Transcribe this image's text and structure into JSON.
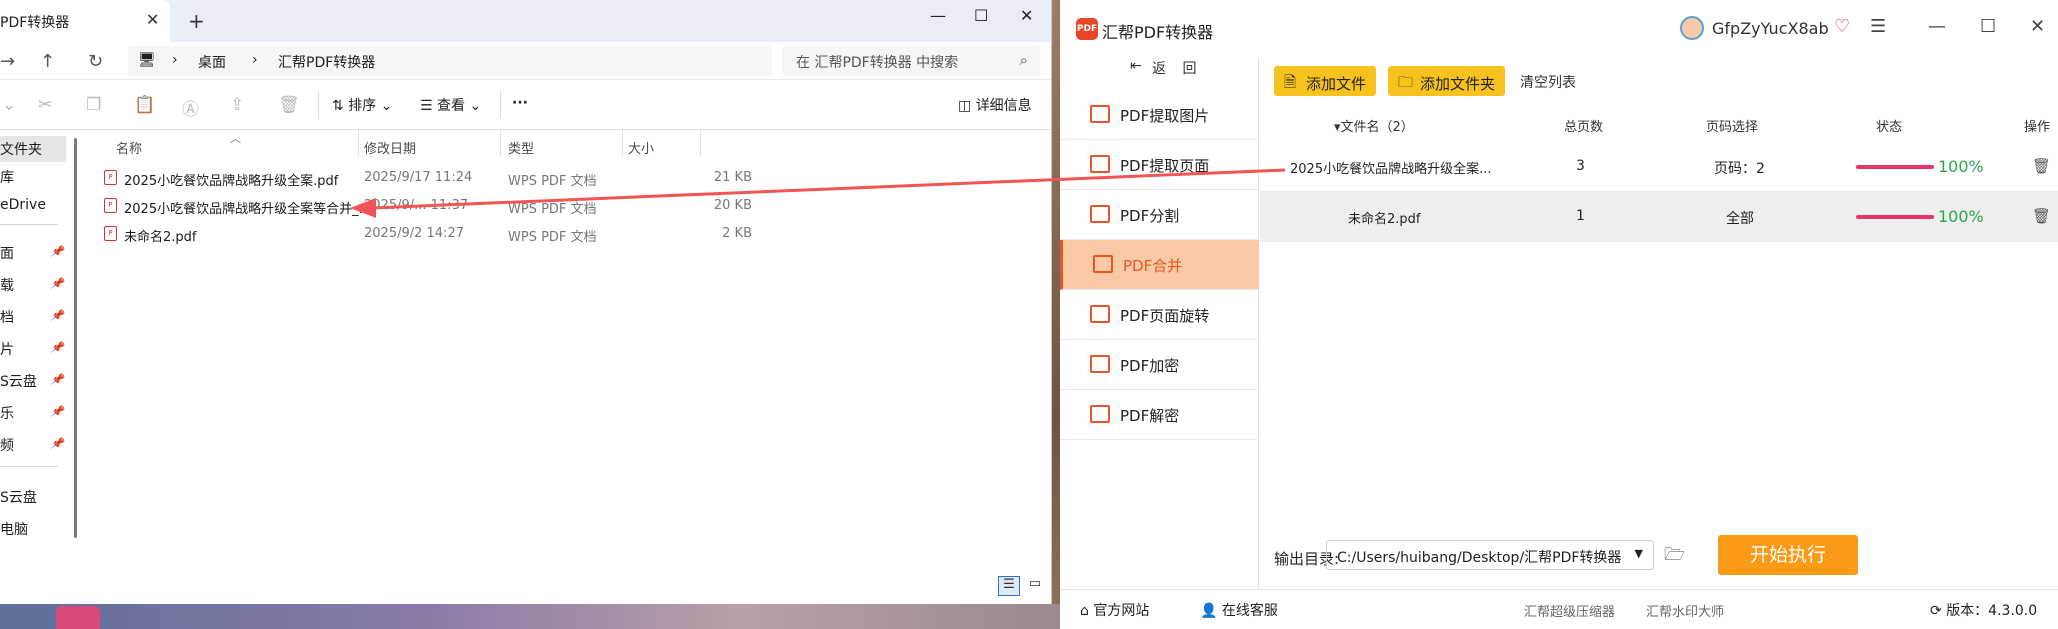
{
  "explorer": {
    "tab_title": "PDF转换器",
    "tab_close": "✕",
    "new_tab": "+",
    "win_controls": [
      "—",
      "☐",
      "✕"
    ],
    "nav": {
      "back": "→",
      "up": "↑",
      "refresh": "↻",
      "pc_icon": "🖥",
      "sep": "›"
    },
    "breadcrumb": [
      "桌面",
      "汇帮PDF转换器"
    ],
    "search_placeholder": "在 汇帮PDF转换器 中搜索",
    "search_icon": "search-icon",
    "toolbar": {
      "sort": "排序",
      "view": "查看",
      "more": "···",
      "details": "详细信息"
    },
    "sidebar": [
      {
        "label": "文件夹",
        "selected": true,
        "pinned": false
      },
      {
        "label": "库",
        "pinned": false
      },
      {
        "label": "eDrive",
        "pinned": false
      },
      {
        "label": "面",
        "pinned": true
      },
      {
        "label": "载",
        "pinned": true
      },
      {
        "label": "档",
        "pinned": true
      },
      {
        "label": "片",
        "pinned": true
      },
      {
        "label": "S云盘",
        "pinned": true
      },
      {
        "label": "乐",
        "pinned": true
      },
      {
        "label": "频",
        "pinned": true
      },
      {
        "label": "S云盘",
        "pinned": false
      },
      {
        "label": "电脑",
        "pinned": false
      }
    ],
    "columns": {
      "name": "名称",
      "modified": "修改日期",
      "type": "类型",
      "size": "大小"
    },
    "files": [
      {
        "name": "2025小吃餐饮品牌战略升级全案.pdf",
        "modified": "2025/9/17 11:24",
        "type": "WPS PDF 文档",
        "size": "21 KB"
      },
      {
        "name": "2025小吃餐饮品牌战略升级全案等合并_...",
        "modified": "2025/9/... 11:37",
        "type": "WPS PDF 文档",
        "size": "20 KB"
      },
      {
        "name": "未命名2.pdf",
        "modified": "2025/9/2 14:27",
        "type": "WPS PDF 文档",
        "size": "2 KB"
      }
    ]
  },
  "app": {
    "logo_text": "PDF",
    "name": "汇帮PDF转换器",
    "user": "GfpZyYucX8ab",
    "win_controls": [
      "☰",
      "—",
      "☐",
      "✕"
    ],
    "back_label": "返 回",
    "menu": [
      {
        "label": "PDF提取图片",
        "active": false
      },
      {
        "label": "PDF提取页面",
        "active": false
      },
      {
        "label": "PDF分割",
        "active": false
      },
      {
        "label": "PDF合并",
        "active": true
      },
      {
        "label": "PDF页面旋转",
        "active": false
      },
      {
        "label": "PDF加密",
        "active": false
      },
      {
        "label": "PDF解密",
        "active": false
      }
    ],
    "buttons": {
      "add_file": "添加文件",
      "add_folder": "添加文件夹",
      "clear": "清空列表"
    },
    "table": {
      "headers": {
        "name": "▾文件名（2）",
        "pages": "总页数",
        "page_select": "页码选择",
        "status": "状态",
        "action": "操作"
      },
      "rows": [
        {
          "name": "2025小吃餐饮品牌战略升级全案...",
          "pages": "3",
          "page_select": "页码：2",
          "progress": 1.0,
          "status": "100%"
        },
        {
          "name": "未命名2.pdf",
          "pages": "1",
          "page_select": "全部",
          "progress": 1.0,
          "status": "100%"
        }
      ]
    },
    "output_label": "输出目录:",
    "output_path": "C:/Users/huibang/Desktop/汇帮PDF转换器",
    "dropdown_arrow": "▼",
    "start_button": "开始执行",
    "footer": {
      "website": "官方网站",
      "service": "在线客服",
      "compressor": "汇帮超级压缩器",
      "watermark": "汇帮水印大师",
      "version": "版本：4.3.0.0"
    }
  },
  "colors": {
    "accent": "#e8552a",
    "button_yellow": "#f7c21b",
    "start_orange": "#fa9a16",
    "progress": "#e8336a",
    "percent_green": "#2aa84a"
  }
}
